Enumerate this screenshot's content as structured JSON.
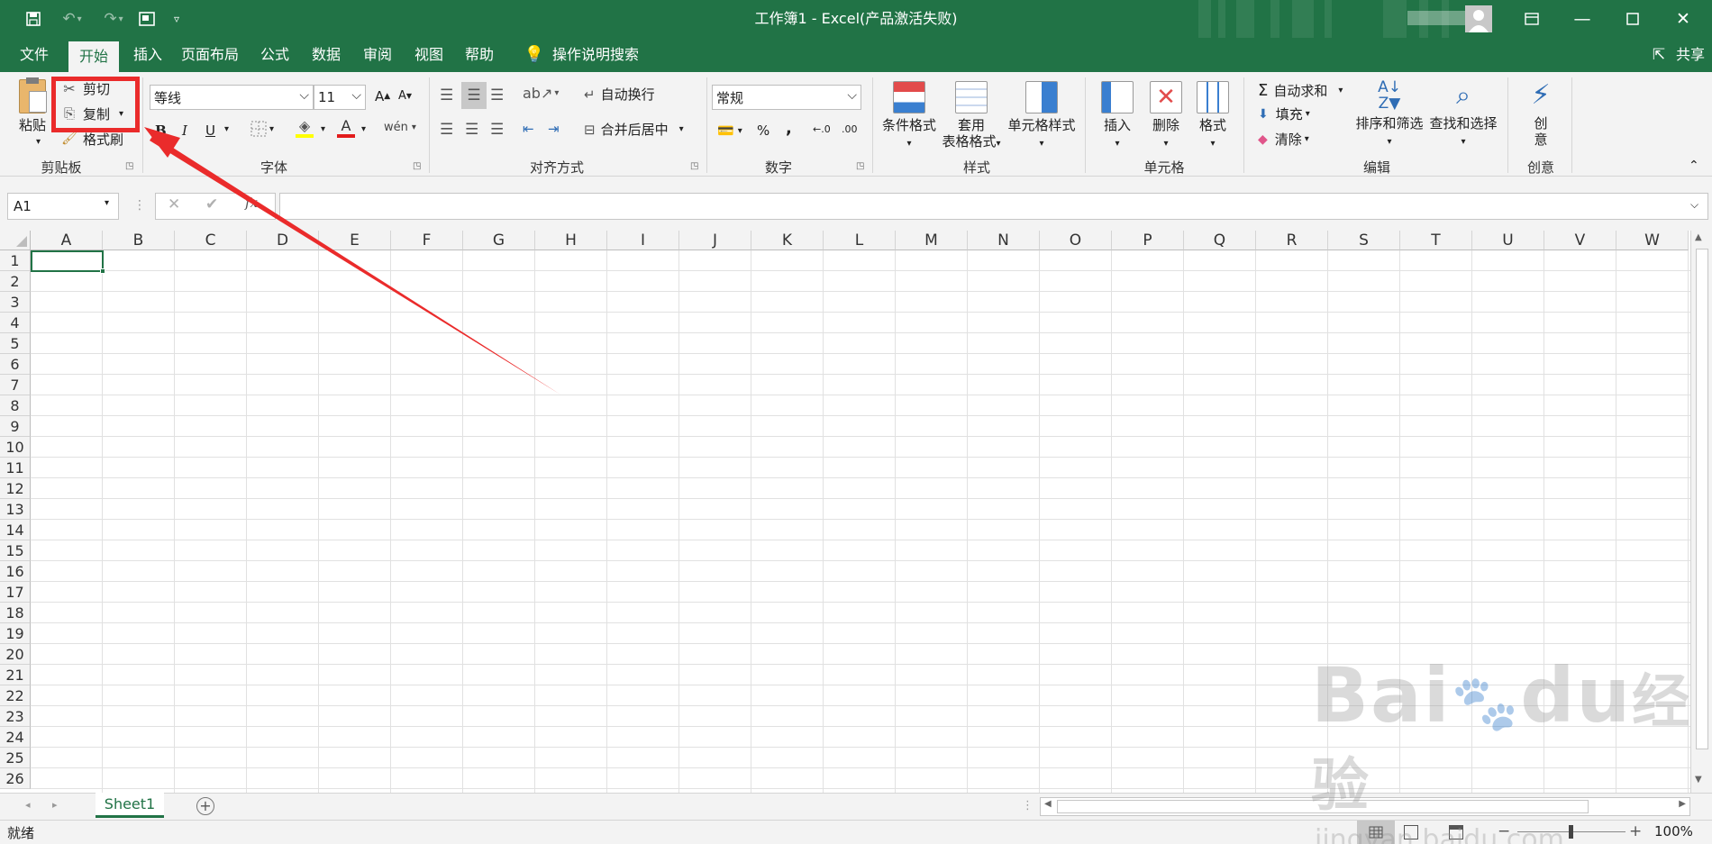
{
  "window": {
    "title": "工作簿1  -  Excel(产品激活失败)",
    "share_label": "共享"
  },
  "tabs": [
    {
      "label": "文件",
      "active": false
    },
    {
      "label": "开始",
      "active": true
    },
    {
      "label": "插入",
      "active": false
    },
    {
      "label": "页面布局",
      "active": false
    },
    {
      "label": "公式",
      "active": false
    },
    {
      "label": "数据",
      "active": false
    },
    {
      "label": "审阅",
      "active": false
    },
    {
      "label": "视图",
      "active": false
    },
    {
      "label": "帮助",
      "active": false
    }
  ],
  "search_label": "操作说明搜索",
  "clipboard": {
    "paste": "粘贴",
    "cut": "剪切",
    "copy": "复制",
    "format_painter": "格式刷",
    "group": "剪贴板"
  },
  "font": {
    "name": "等线",
    "size": "11",
    "group": "字体",
    "bold": "B",
    "italic": "I",
    "underline": "U",
    "grow": "A",
    "shrink": "A"
  },
  "alignment": {
    "wrap": "自动换行",
    "merge": "合并后居中",
    "group": "对齐方式"
  },
  "number": {
    "format": "常规",
    "percent": "%",
    "comma": ",",
    "inc_decimal": "←.0",
    "dec_decimal": ".00",
    "group": "数字"
  },
  "styles": {
    "conditional": "条件格式",
    "table1": "套用",
    "table2": "表格格式",
    "cell_styles": "单元格样式",
    "group": "样式"
  },
  "cells": {
    "insert": "插入",
    "delete": "删除",
    "format": "格式",
    "group": "单元格"
  },
  "editing": {
    "autosum": "自动求和",
    "fill": "填充",
    "clear": "清除",
    "sort": "排序和筛选",
    "find": "查找和选择",
    "group": "编辑"
  },
  "create": {
    "label1": "创",
    "label2": "意",
    "group": "创意"
  },
  "namebox": "A1",
  "fx": "fx",
  "columns": [
    "A",
    "B",
    "C",
    "D",
    "E",
    "F",
    "G",
    "H",
    "I",
    "J",
    "K",
    "L",
    "M",
    "N",
    "O",
    "P",
    "Q",
    "R",
    "S",
    "T",
    "U",
    "V",
    "W"
  ],
  "rows": [
    "1",
    "2",
    "3",
    "4",
    "5",
    "6",
    "7",
    "8",
    "9",
    "10",
    "11",
    "12",
    "13",
    "14",
    "15",
    "16",
    "17",
    "18",
    "19",
    "20",
    "21",
    "22",
    "23",
    "24",
    "25",
    "26"
  ],
  "sheet": {
    "name": "Sheet1"
  },
  "status": {
    "ready": "就绪",
    "zoom": "100%"
  },
  "watermark": {
    "brand": "Bai",
    "brand2": "du",
    "cn": "经验",
    "url": "jingyan.baidu.com"
  },
  "colors": {
    "excel_green": "#217346",
    "highlight_red": "#ea2b2b"
  }
}
